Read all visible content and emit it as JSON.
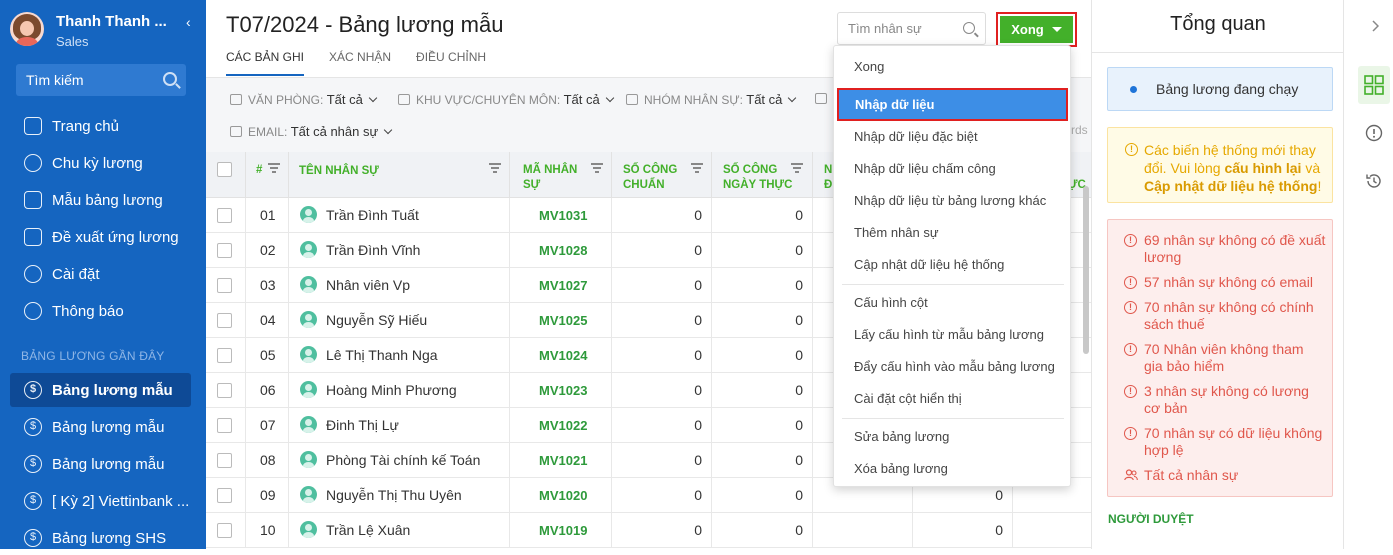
{
  "user": {
    "name": "Thanh Thanh ...",
    "role": "Sales"
  },
  "sidebar": {
    "search_placeholder": "Tìm kiếm",
    "items": [
      {
        "label": "Trang chủ"
      },
      {
        "label": "Chu kỳ lương"
      },
      {
        "label": "Mẫu bảng lương"
      },
      {
        "label": "Đề xuất ứng lương"
      },
      {
        "label": "Cài đặt"
      },
      {
        "label": "Thông báo"
      }
    ],
    "recent_heading": "BẢNG LƯƠNG GẦN ĐÂY",
    "recent": [
      {
        "label": "Bảng lương mẫu"
      },
      {
        "label": "Bảng lương mẫu"
      },
      {
        "label": "Bảng lương mẫu"
      },
      {
        "label": "[ Kỳ 2] Viettinbank ..."
      },
      {
        "label": "Bảng lương SHS"
      }
    ]
  },
  "header": {
    "title": "T07/2024 - Bảng lương mẫu",
    "tabs": [
      "CÁC BẢN GHI",
      "XÁC NHẬN",
      "ĐIỀU CHỈNH"
    ],
    "employee_search_placeholder": "Tìm nhân sự",
    "done_button": "Xong"
  },
  "filters": [
    {
      "label": "VĂN PHÒNG:",
      "value": "Tất cả"
    },
    {
      "label": "KHU VỰC/CHUYÊN MÔN:",
      "value": "Tất cả"
    },
    {
      "label": "NHÓM NHÂN SỰ:",
      "value": "Tất cả"
    },
    {
      "label": "EMAIL:",
      "value": "Tất cả nhân sự"
    }
  ],
  "filter_fragment": "rds",
  "table": {
    "headers": {
      "num": "#",
      "name": "TÊN NHÂN SỰ",
      "code_1": "MÃ NHÂN",
      "code_2": "SỰ",
      "std_1": "SỐ CÔNG",
      "std_2": "CHUẨN",
      "act_1": "SỐ CÔNG",
      "act_2": "NGÀY THỰC",
      "n1_1": "N",
      "n1_2": "Đ",
      "tail": "ỰC"
    },
    "rows": [
      {
        "num": "01",
        "name": "Trần Đình Tuất",
        "code": "MV1031",
        "std": "0",
        "actual": "0"
      },
      {
        "num": "02",
        "name": "Trần Đình Vĩnh",
        "code": "MV1028",
        "std": "0",
        "actual": "0"
      },
      {
        "num": "03",
        "name": "Nhân viên Vp",
        "code": "MV1027",
        "std": "0",
        "actual": "0"
      },
      {
        "num": "04",
        "name": "Nguyễn Sỹ Hiếu",
        "code": "MV1025",
        "std": "0",
        "actual": "0"
      },
      {
        "num": "05",
        "name": "Lê Thị Thanh Nga",
        "code": "MV1024",
        "std": "0",
        "actual": "0"
      },
      {
        "num": "06",
        "name": "Hoàng Minh Phương",
        "code": "MV1023",
        "std": "0",
        "actual": "0"
      },
      {
        "num": "07",
        "name": "Đinh Thị Lự",
        "code": "MV1022",
        "std": "0",
        "actual": "0"
      },
      {
        "num": "08",
        "name": "Phòng Tài chính kế Toán",
        "code": "MV1021",
        "std": "0",
        "actual": "0"
      },
      {
        "num": "09",
        "name": "Nguyễn Thị Thu Uyên",
        "code": "MV1020",
        "std": "0",
        "actual": "0",
        "extra": "0"
      },
      {
        "num": "10",
        "name": "Trần Lệ Xuân",
        "code": "MV1019",
        "std": "0",
        "actual": "0",
        "extra": "0"
      }
    ]
  },
  "menu": {
    "items": [
      "Xong",
      "Nhập dữ liệu",
      "Nhập dữ liệu đặc biệt",
      "Nhập dữ liệu chấm công",
      "Nhập dữ liệu từ bảng lương khác",
      "Thêm nhân sự",
      "Cập nhật dữ liệu hệ thống",
      "Cấu hình cột",
      "Lấy cấu hình từ mẫu bảng lương",
      "Đẩy cấu hình vào mẫu bảng lương",
      "Cài đặt cột hiển thị",
      "Sửa bảng lương",
      "Xóa bảng lương"
    ]
  },
  "overview": {
    "title": "Tổng quan",
    "running": "Bảng lương đang chạy",
    "warning_text_1": "Các biến hệ thống mới thay đổi. Vui lòng ",
    "warning_link_1": "cấu hình lại",
    "warning_text_2": " và ",
    "warning_link_2": "Cập nhật dữ liệu hệ thống",
    "warning_text_3": "!",
    "errors": [
      "69 nhân sự không có đề xuất lương",
      "57 nhân sự không có email",
      "70 nhân sự không có chính sách thuế",
      "70 Nhân viên không tham gia bảo hiểm",
      "3 nhân sự không có lương cơ bản",
      "70 nhân sự có dữ liệu không hợp lệ"
    ],
    "all_employees": "Tất cả nhân sự",
    "approver_heading": "NGƯỜI DUYỆT"
  },
  "colors": {
    "sidebar": "#1565c0",
    "accent_green": "#43b02a",
    "highlight": "#3d8ee6",
    "error": "#e0574c",
    "warning": "#e6a800"
  },
  "icons": [
    "search-icon",
    "home-icon",
    "cycle-icon",
    "template-icon",
    "advance-icon",
    "settings-icon",
    "bell-icon",
    "dollar-icon",
    "grid-icon",
    "info-icon",
    "history-icon"
  ]
}
